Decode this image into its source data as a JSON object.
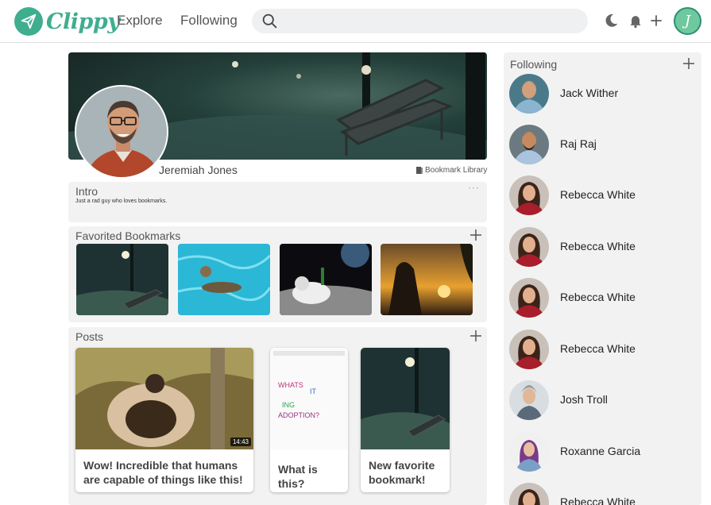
{
  "app": {
    "name": "Clippy",
    "brand_color": "#3fae8f"
  },
  "nav": {
    "explore": "Explore",
    "following": "Following"
  },
  "search": {
    "placeholder": ""
  },
  "user": {
    "avatar_initial": "J"
  },
  "profile": {
    "name": "Jeremiah Jones",
    "bookmark_library": "Bookmark Library"
  },
  "intro": {
    "title": "Intro",
    "text": "Just a rad guy who loves bookmarks.",
    "menu": "···"
  },
  "favorites": {
    "title": "Favorited Bookmarks",
    "items": [
      {
        "icon": "night-park-photo"
      },
      {
        "icon": "swimmer-photo"
      },
      {
        "icon": "astronaut-photo"
      },
      {
        "icon": "sunset-photo"
      }
    ]
  },
  "posts": {
    "title": "Posts",
    "items": [
      {
        "caption": "Wow! Incredible that humans are capable of things like this!",
        "duration": "14:43"
      },
      {
        "caption": "What is this?"
      },
      {
        "caption": "New favorite bookmark!"
      }
    ]
  },
  "following": {
    "title": "Following",
    "people": [
      {
        "name": "Jack Wither"
      },
      {
        "name": "Raj Raj"
      },
      {
        "name": "Rebecca White"
      },
      {
        "name": "Rebecca White"
      },
      {
        "name": "Rebecca White"
      },
      {
        "name": "Rebecca White"
      },
      {
        "name": "Josh Troll"
      },
      {
        "name": "Roxanne Garcia"
      },
      {
        "name": "Rebecca White"
      }
    ]
  }
}
